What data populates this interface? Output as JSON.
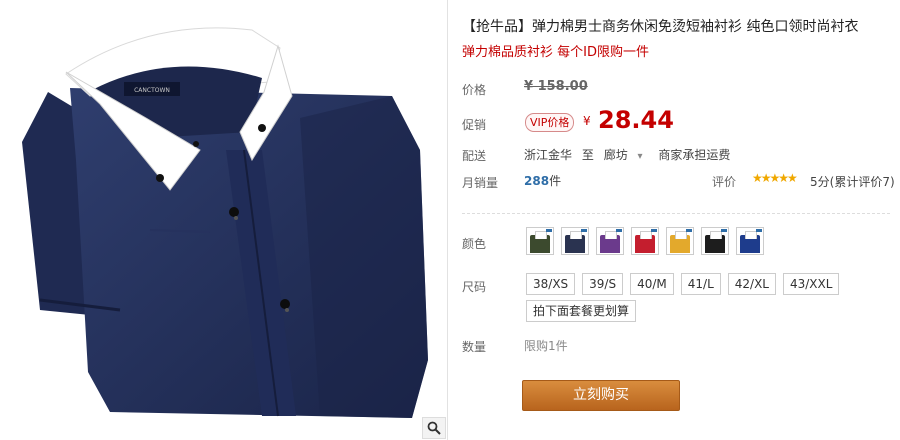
{
  "product": {
    "title": "【抢牛品】弹力棉男士商务休闲免烫短袖衬衫 纯色口领时尚衬衣",
    "subtitle": "弹力棉品质衬衫 每个ID限购一件"
  },
  "price": {
    "label": "价格",
    "original": "¥ 158.00",
    "promo_label": "促销",
    "vip_badge": "VIP价格",
    "currency": "¥",
    "current": "28.44"
  },
  "shipping": {
    "label": "配送",
    "from": "浙江金华",
    "to_word": "至",
    "to": "廊坊",
    "dropdown_glyph": "▾",
    "fee": "商家承担运费"
  },
  "sales": {
    "label": "月销量",
    "count": "288",
    "unit": "件",
    "rating_label": "评价",
    "stars": "★★★★★",
    "rating_text": "5分(累计评价7)"
  },
  "color": {
    "label": "颜色",
    "swatches": [
      "#3c4a2e",
      "#2a3350",
      "#6b3a8c",
      "#c41e2e",
      "#e3a92c",
      "#1d1d1d",
      "#1e3c8c"
    ]
  },
  "size": {
    "label": "尺码",
    "options": [
      "38/XS",
      "39/S",
      "40/M",
      "41/L",
      "42/XL",
      "43/XXL"
    ],
    "combo_button": "拍下面套餐更划算"
  },
  "quantity": {
    "label": "数量",
    "limit": "限购1件"
  },
  "buy_button": "立刻购买",
  "colors": {
    "accent_red": "#c40000",
    "buy_orange": "#c97a2e",
    "link_blue": "#2f6ea8"
  }
}
